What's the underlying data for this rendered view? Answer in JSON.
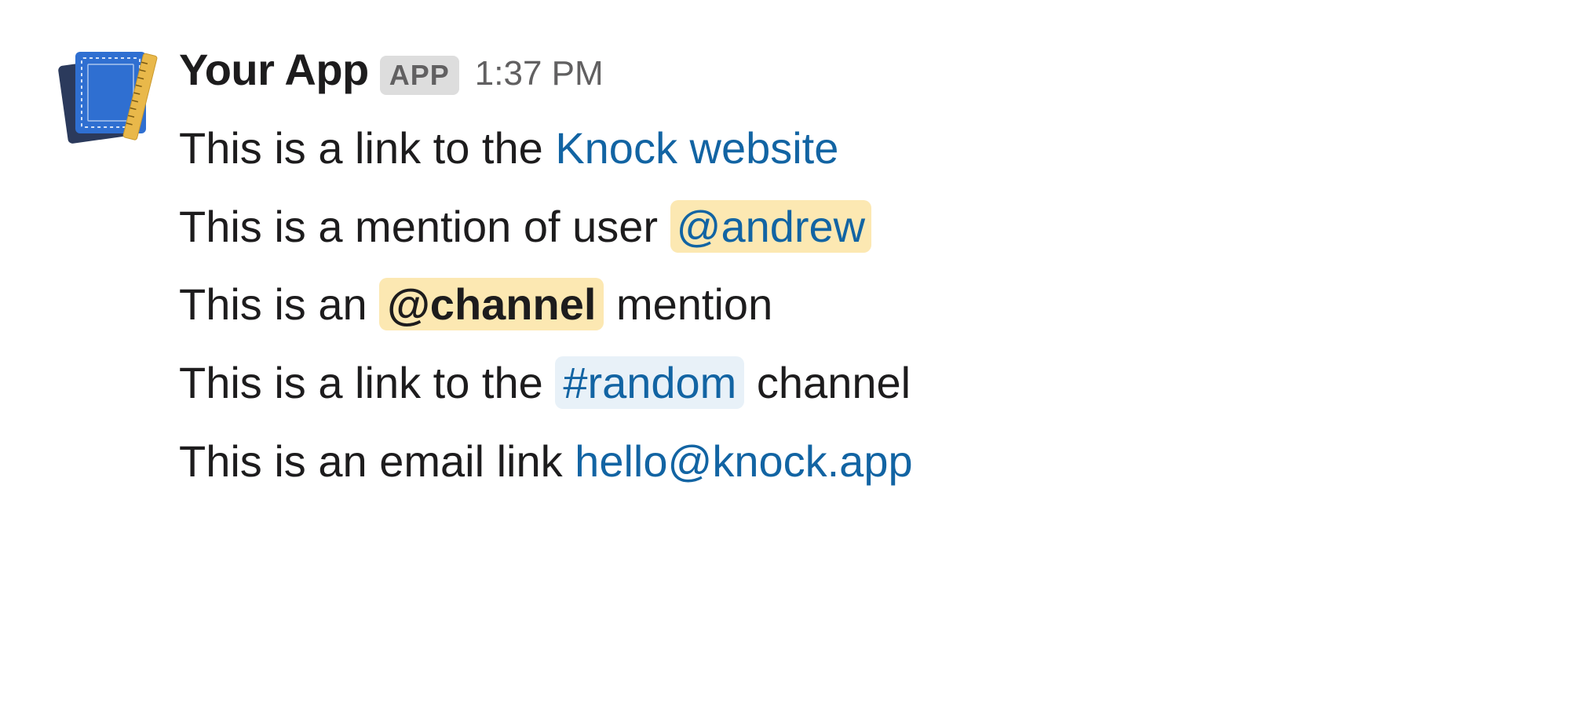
{
  "message": {
    "sender_name": "Your App",
    "app_badge": "APP",
    "timestamp": "1:37 PM",
    "lines": {
      "l1_prefix": "This is a link to the ",
      "l1_link": "Knock website",
      "l2_prefix": "This is a mention of user ",
      "l2_mention": "@andrew",
      "l3_prefix": "This is an ",
      "l3_mention": "@channel",
      "l3_suffix": " mention",
      "l4_prefix": "This is a link to the ",
      "l4_channel": "#random",
      "l4_suffix": " channel",
      "l5_prefix": "This is an email link ",
      "l5_email": "hello@knock.app"
    }
  }
}
